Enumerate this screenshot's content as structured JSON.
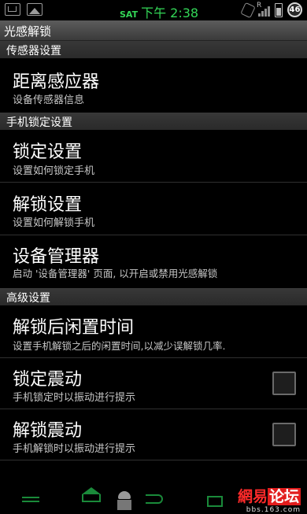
{
  "status_bar": {
    "day": "SAT",
    "time": "下午 2:38",
    "roaming": "R",
    "badge_count": "46",
    "time_color": "#33d657"
  },
  "title": "光感解锁",
  "sections": {
    "sensor": "传感器设置",
    "lock": "手机锁定设置",
    "advanced": "高级设置"
  },
  "rows": {
    "proximity": {
      "title": "距离感应器",
      "subtitle": "设备传感器信息"
    },
    "lock_settings": {
      "title": "锁定设置",
      "subtitle": "设置如何锁定手机"
    },
    "unlock_settings": {
      "title": "解锁设置",
      "subtitle": "设置如何解锁手机"
    },
    "device_admin": {
      "title": "设备管理器",
      "subtitle": "启动 '设备管理器' 页面, 以开启或禁用光感解锁"
    },
    "idle_time": {
      "title": "解锁后闲置时间",
      "subtitle": "设置手机解锁之后的闲置时间,以减少误解锁几率."
    },
    "lock_vibrate": {
      "title": "锁定震动",
      "subtitle": "手机锁定时以振动进行提示",
      "checked": false
    },
    "unlock_vibrate": {
      "title": "解锁震动",
      "subtitle": "手机解锁时以振动进行提示",
      "checked": false
    }
  },
  "watermark": {
    "logo_part1": "網易",
    "logo_part2": "论坛",
    "url": "bbs.163.com"
  }
}
